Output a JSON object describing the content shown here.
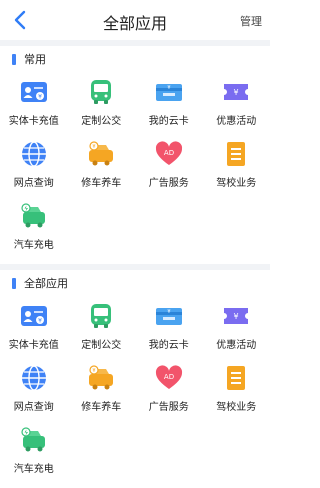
{
  "header": {
    "title": "全部应用",
    "manage_label": "管理"
  },
  "sections": [
    {
      "title": "常用",
      "items": [
        {
          "label": "实体卡充值",
          "icon": "card-recharge-icon"
        },
        {
          "label": "定制公交",
          "icon": "bus-icon"
        },
        {
          "label": "我的云卡",
          "icon": "cloud-card-icon"
        },
        {
          "label": "优惠活动",
          "icon": "coupon-icon"
        },
        {
          "label": "网点查询",
          "icon": "globe-icon"
        },
        {
          "label": "修车养车",
          "icon": "car-repair-icon"
        },
        {
          "label": "广告服务",
          "icon": "ad-heart-icon"
        },
        {
          "label": "驾校业务",
          "icon": "driving-school-icon"
        },
        {
          "label": "汽车充电",
          "icon": "ev-charging-icon"
        }
      ]
    },
    {
      "title": "全部应用",
      "items": [
        {
          "label": "实体卡充值",
          "icon": "card-recharge-icon"
        },
        {
          "label": "定制公交",
          "icon": "bus-icon"
        },
        {
          "label": "我的云卡",
          "icon": "cloud-card-icon"
        },
        {
          "label": "优惠活动",
          "icon": "coupon-icon"
        },
        {
          "label": "网点查询",
          "icon": "globe-icon"
        },
        {
          "label": "修车养车",
          "icon": "car-repair-icon"
        },
        {
          "label": "广告服务",
          "icon": "ad-heart-icon"
        },
        {
          "label": "驾校业务",
          "icon": "driving-school-icon"
        },
        {
          "label": "汽车充电",
          "icon": "ev-charging-icon"
        }
      ]
    }
  ],
  "colors": {
    "accent": "#3f82f6",
    "green": "#37c07a",
    "orange": "#f5a623",
    "purple": "#7a6cf0",
    "pink": "#f2546b"
  }
}
